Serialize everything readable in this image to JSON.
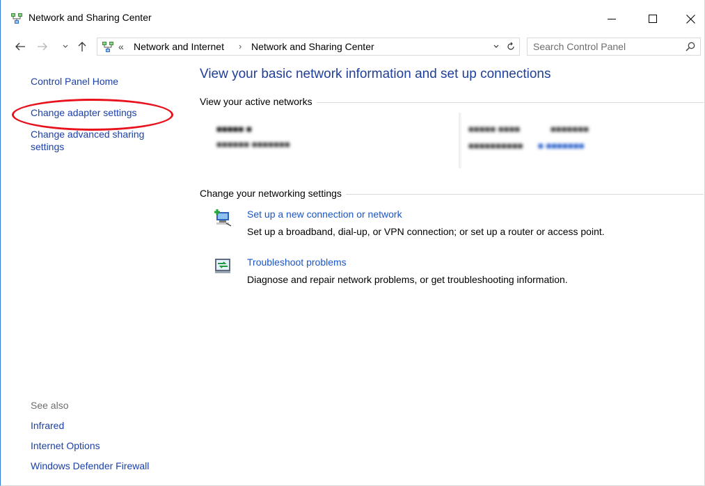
{
  "window": {
    "title": "Network and Sharing Center",
    "icons": {
      "app": "network-icon",
      "minimize": "minimize-icon",
      "maximize": "maximize-icon",
      "close": "close-icon"
    }
  },
  "navbar": {
    "icons": {
      "back": "arrow-left-icon",
      "forward": "arrow-right-icon",
      "recent": "chevron-down-icon",
      "up": "arrow-up-icon",
      "address": "network-icon",
      "dropdown": "chevron-down-icon",
      "refresh": "refresh-icon"
    },
    "overflow": "«",
    "breadcrumbs": [
      "Network and Internet",
      "Network and Sharing Center"
    ],
    "separator": "›",
    "search_placeholder": "Search Control Panel",
    "search_value": ""
  },
  "leftpane": {
    "home": "Control Panel Home",
    "adapter": "Change adapter settings",
    "advanced": "Change advanced sharing settings",
    "see_also": "See also",
    "see_also_links": [
      "Infrared",
      "Internet Options",
      "Windows Defender Firewall"
    ]
  },
  "main": {
    "title": "View your basic network information and set up connections",
    "active_networks_header": "View your active networks",
    "change_settings_header": "Change your networking settings",
    "tasks": [
      {
        "icon": "new-connection-icon",
        "link": "Set up a new connection or network",
        "description": "Set up a broadband, dial-up, or VPN connection; or set up a router or access point."
      },
      {
        "icon": "troubleshoot-icon",
        "link": "Troubleshoot problems",
        "description": "Diagnose and repair network problems, or get troubleshooting information."
      }
    ]
  },
  "colors": {
    "link": "#1a55c8",
    "title": "#1e3f9a",
    "highlight": "#e8111c",
    "border": "#2b7bd6"
  }
}
